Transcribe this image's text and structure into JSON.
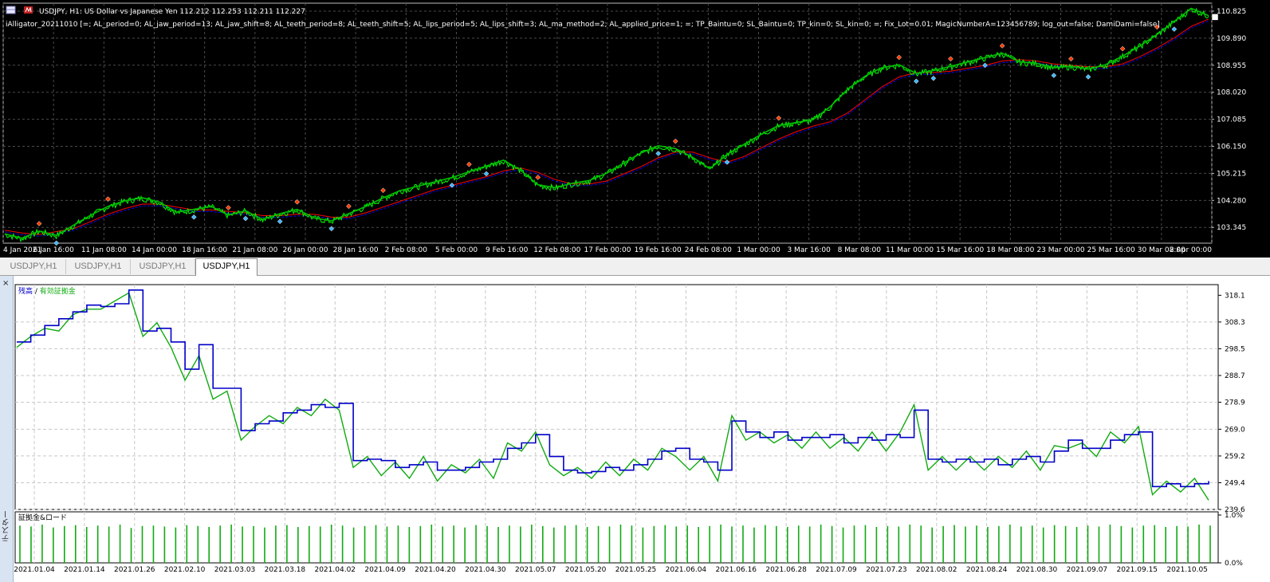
{
  "chart_window": {
    "symbol_line": "USDJPY, H1:  US Dollar vs Japanese Yen  112.212 112.253 112.211 112.227",
    "indicator_line": "iAlligator_20211010 [=; AL_period=0; AL_jaw_period=13; AL_jaw_shift=8; AL_teeth_period=8; AL_teeth_shift=5; AL_lips_period=5; AL_lips_shift=3; AL_ma_method=2; AL_applied_price=1; =; TP_Baintu=0; SL_Baintu=0; TP_kin=0; SL_kin=0; =; Fix_Lot=0.01; MagicNumberA=123456789; log_out=false; DamiDami=false]",
    "colors": {
      "background": "#000000",
      "grid": "#4a4a4a",
      "price": "#00ff00",
      "jaw": "#0000ff",
      "teeth": "#ff0000",
      "lips": "#00c000",
      "buy_marker": "#ff3b00",
      "sell_marker": "#3db7ff"
    }
  },
  "tabs": [
    {
      "label": "USDJPY,H1",
      "active": false
    },
    {
      "label": "USDJPY,H1",
      "active": false
    },
    {
      "label": "USDJPY,H1",
      "active": false
    },
    {
      "label": "USDJPY,H1",
      "active": true
    }
  ],
  "tester": {
    "side_label": "テスター",
    "close_label": "×",
    "legend_balance": "残高",
    "legend_sep": " / ",
    "legend_equity": "有効証拠金",
    "load_label": "証拠金&ロード",
    "colors": {
      "balance": "#0000c8",
      "equity": "#11aa11",
      "load_bar": "#11aa11",
      "grid": "#c8c8c8"
    }
  },
  "chart_data": [
    {
      "type": "line",
      "title": "USDJPY, H1",
      "x_tick_labels": [
        "4 Jan 2021",
        "6 Jan 16:00",
        "11 Jan 08:00",
        "14 Jan 00:00",
        "18 Jan 16:00",
        "21 Jan 08:00",
        "26 Jan 00:00",
        "28 Jan 16:00",
        "2 Feb 08:00",
        "5 Feb 00:00",
        "9 Feb 16:00",
        "12 Feb 08:00",
        "17 Feb 00:00",
        "19 Feb 16:00",
        "24 Feb 08:00",
        "1 Mar 00:00",
        "3 Mar 16:00",
        "8 Mar 08:00",
        "11 Mar 00:00",
        "15 Mar 16:00",
        "18 Mar 08:00",
        "23 Mar 00:00",
        "25 Mar 16:00",
        "30 Mar 08:00",
        "2 Apr 00:00"
      ],
      "y_tick_labels": [
        "110.825",
        "109.890",
        "108.955",
        "108.020",
        "107.085",
        "106.150",
        "105.215",
        "104.280",
        "103.345"
      ],
      "ylim": [
        102.8,
        111.1
      ],
      "grid": true,
      "series": [
        {
          "values": [
            103.1,
            102.95,
            103.2,
            103.05,
            103.4,
            103.75,
            104.05,
            104.25,
            104.35,
            104.2,
            103.85,
            103.95,
            104.05,
            103.75,
            103.9,
            103.6,
            103.8,
            103.95,
            103.65,
            103.55,
            103.8,
            104.05,
            104.35,
            104.6,
            104.75,
            104.9,
            105.05,
            105.25,
            105.45,
            105.65,
            105.3,
            104.8,
            104.7,
            104.85,
            104.95,
            105.2,
            105.55,
            105.9,
            106.15,
            106.05,
            105.75,
            105.35,
            105.85,
            106.2,
            106.55,
            106.85,
            106.95,
            107.05,
            107.5,
            108.1,
            108.55,
            108.85,
            108.95,
            108.65,
            108.75,
            108.9,
            109.05,
            109.2,
            109.35,
            109.05,
            109.0,
            108.85,
            108.9,
            108.8,
            108.95,
            109.25,
            109.6,
            110.0,
            110.45,
            110.9,
            110.65
          ]
        },
        {
          "values": [
            103.25,
            103.15,
            103.1,
            103.2,
            103.3,
            103.55,
            103.8,
            104.0,
            104.15,
            104.15,
            104.05,
            103.95,
            103.95,
            103.9,
            103.85,
            103.75,
            103.75,
            103.8,
            103.8,
            103.7,
            103.7,
            103.85,
            104.05,
            104.25,
            104.45,
            104.65,
            104.8,
            104.95,
            105.1,
            105.3,
            105.4,
            105.25,
            105.0,
            104.85,
            104.85,
            104.95,
            105.2,
            105.45,
            105.75,
            105.95,
            105.95,
            105.75,
            105.6,
            105.8,
            106.1,
            106.4,
            106.65,
            106.85,
            107.0,
            107.3,
            107.75,
            108.2,
            108.55,
            108.7,
            108.7,
            108.75,
            108.85,
            108.95,
            109.1,
            109.15,
            109.1,
            109.0,
            108.95,
            108.9,
            108.9,
            109.0,
            109.25,
            109.55,
            109.9,
            110.3,
            110.55
          ]
        }
      ]
    },
    {
      "type": "line",
      "legend": [
        "残高",
        "有効証拠金"
      ],
      "x_tick_labels": [
        "2021.01.04",
        "2021.01.14",
        "2021.01.26",
        "2021.02.10",
        "2021.03.03",
        "2021.03.18",
        "2021.04.02",
        "2021.04.09",
        "2021.04.20",
        "2021.04.30",
        "2021.05.07",
        "2021.05.20",
        "2021.05.25",
        "2021.06.04",
        "2021.06.16",
        "2021.06.28",
        "2021.07.09",
        "2021.07.23",
        "2021.08.02",
        "2021.08.24",
        "2021.08.30",
        "2021.09.07",
        "2021.09.15",
        "2021.10.05"
      ],
      "y_tick_labels": [
        "318.1",
        "308.3",
        "298.5",
        "288.7",
        "278.9",
        "269.0",
        "259.2",
        "249.4",
        "239.6"
      ],
      "ylim": [
        239.6,
        322.0
      ],
      "grid": true,
      "series": [
        {
          "name": "残高",
          "values": [
            301.0,
            303.5,
            307.0,
            309.5,
            312.0,
            314.5,
            314.0,
            315.0,
            320.0,
            305.0,
            306.0,
            301.0,
            291.0,
            300.0,
            284.0,
            284.0,
            268.5,
            271.0,
            272.0,
            275.0,
            276.0,
            278.0,
            277.0,
            278.5,
            257.5,
            258.0,
            257.5,
            255.0,
            256.0,
            257.0,
            254.0,
            254.0,
            255.0,
            257.0,
            258.0,
            262.0,
            264.0,
            267.0,
            259.0,
            254.0,
            253.0,
            253.5,
            255.0,
            254.0,
            256.0,
            258.0,
            261.0,
            262.0,
            258.0,
            257.0,
            254.0,
            272.0,
            268.0,
            266.0,
            268.0,
            265.0,
            266.0,
            266.0,
            267.0,
            264.0,
            266.0,
            265.0,
            267.0,
            266.0,
            276.0,
            258.0,
            257.0,
            258.0,
            257.0,
            258.0,
            256.0,
            258.0,
            259.0,
            257.0,
            261.0,
            265.0,
            262.0,
            262.0,
            265.0,
            267.0,
            268.0,
            248.0,
            249.0,
            248.0,
            249.0,
            250.0
          ]
        },
        {
          "name": "有効証拠金",
          "values": [
            299.0,
            303.0,
            306.0,
            305.0,
            311.0,
            313.0,
            313.0,
            316.0,
            319.0,
            303.0,
            308.0,
            299.0,
            287.0,
            296.0,
            280.0,
            283.0,
            265.0,
            270.0,
            274.0,
            271.0,
            277.0,
            274.0,
            280.0,
            276.0,
            255.0,
            259.0,
            252.0,
            257.0,
            251.0,
            259.0,
            250.0,
            256.0,
            253.0,
            258.0,
            251.0,
            264.0,
            261.0,
            268.0,
            256.0,
            252.0,
            255.0,
            251.0,
            257.0,
            252.0,
            258.0,
            254.0,
            262.0,
            259.0,
            254.0,
            259.0,
            250.0,
            274.0,
            265.0,
            268.0,
            264.0,
            267.0,
            262.0,
            268.0,
            262.0,
            266.0,
            261.0,
            268.0,
            261.0,
            268.0,
            278.0,
            254.0,
            259.0,
            254.0,
            259.0,
            254.0,
            259.0,
            255.0,
            261.0,
            254.0,
            263.0,
            262.0,
            264.0,
            259.0,
            268.0,
            264.0,
            270.0,
            245.0,
            250.0,
            246.0,
            251.0,
            243.0
          ]
        }
      ]
    },
    {
      "type": "bar",
      "title": "証拠金&ロード",
      "y_tick_labels": [
        "1.0%",
        "0.0%"
      ],
      "ylim": [
        0,
        1.0
      ],
      "values": [
        0.78,
        0.76,
        0.8,
        0.74,
        0.77,
        0.79,
        0.75,
        0.78,
        0.76,
        0.8,
        0.73,
        0.77,
        0.78,
        0.76,
        0.74,
        0.79,
        0.77,
        0.75,
        0.78,
        0.8,
        0.76,
        0.77,
        0.74,
        0.78,
        0.79,
        0.75,
        0.77,
        0.76,
        0.8,
        0.78,
        0.74,
        0.77,
        0.79,
        0.76,
        0.78,
        0.75,
        0.77,
        0.8,
        0.76,
        0.78,
        0.74,
        0.79,
        0.77,
        0.75,
        0.78,
        0.76,
        0.8,
        0.77,
        0.74,
        0.78,
        0.79,
        0.75,
        0.77,
        0.76,
        0.8,
        0.78,
        0.74,
        0.77,
        0.79,
        0.76,
        0.78,
        0.75,
        0.77,
        0.8,
        0.76,
        0.78,
        0.74,
        0.79,
        0.77,
        0.75,
        0.78,
        0.76,
        0.8,
        0.77,
        0.74,
        0.78,
        0.79,
        0.75,
        0.77,
        0.76,
        0.8,
        0.78,
        0.74,
        0.77,
        0.79,
        0.76,
        0.78,
        0.75,
        0.77,
        0.8,
        0.76,
        0.78,
        0.74,
        0.79,
        0.77,
        0.75,
        0.78,
        0.76,
        0.8,
        0.77,
        0.74,
        0.78,
        0.79,
        0.75,
        0.77,
        0.76,
        0.8,
        0.78
      ]
    }
  ]
}
